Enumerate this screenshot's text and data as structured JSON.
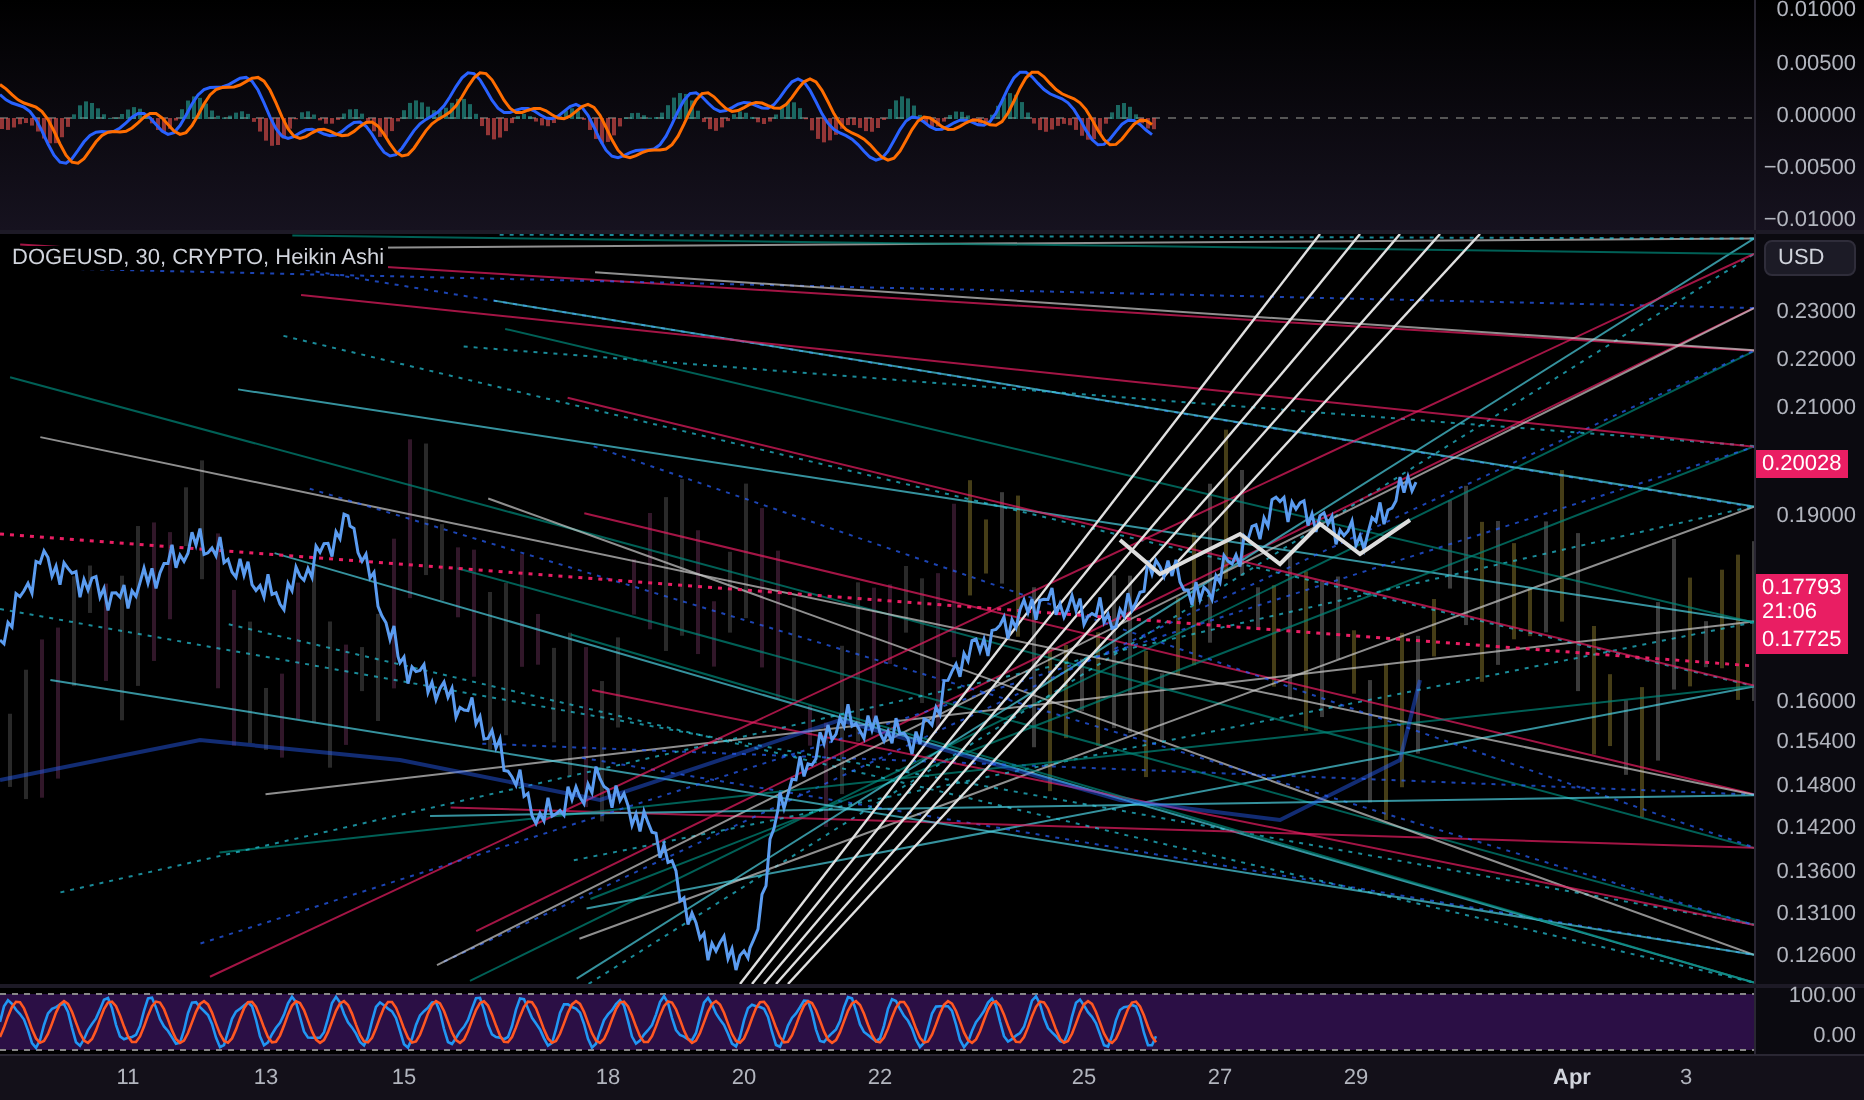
{
  "macd_pane": {
    "axis_labels": [
      "0.01000",
      "0.00500",
      "0.00000",
      "−0.00500",
      "−0.01000"
    ]
  },
  "price_pane": {
    "symbol_legend": "DOGEUSD, 30, CRYPTO, Heikin Ashi",
    "currency_button": "USD",
    "axis_labels": [
      "0.23000",
      "0.22000",
      "0.21000",
      "0.19000",
      "0.16000",
      "0.15400",
      "0.14800",
      "0.14200",
      "0.13600",
      "0.13100",
      "0.12600"
    ],
    "price_tags": [
      {
        "kind": "single",
        "texts": [
          "0.20028"
        ]
      },
      {
        "kind": "countdown",
        "texts": [
          "0.17793",
          "21:06"
        ]
      },
      {
        "kind": "single",
        "texts": [
          "0.17725"
        ]
      }
    ]
  },
  "stoch_pane": {
    "axis_labels": [
      "100.00",
      "0.00"
    ]
  },
  "time_axis": {
    "labels": [
      {
        "text": "11",
        "kind": "day"
      },
      {
        "text": "13",
        "kind": "day"
      },
      {
        "text": "15",
        "kind": "day"
      },
      {
        "text": "18",
        "kind": "day"
      },
      {
        "text": "20",
        "kind": "day"
      },
      {
        "text": "22",
        "kind": "day"
      },
      {
        "text": "25",
        "kind": "day"
      },
      {
        "text": "27",
        "kind": "day"
      },
      {
        "text": "29",
        "kind": "day"
      },
      {
        "text": "Apr",
        "kind": "month"
      },
      {
        "text": "3",
        "kind": "day"
      }
    ]
  }
}
